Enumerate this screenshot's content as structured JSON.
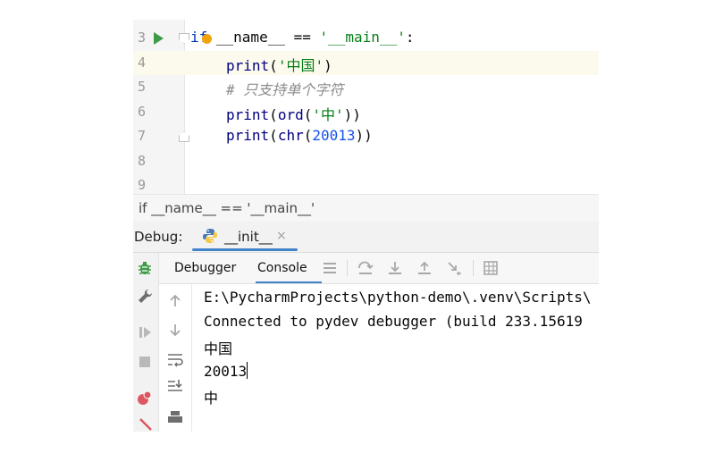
{
  "editor": {
    "lines": [
      {
        "number": "3",
        "parts": [
          {
            "t": "if",
            "c": "kw"
          },
          {
            "t": " __name__ == ",
            "c": "dunder"
          },
          {
            "t": "'__main__'",
            "c": "str"
          },
          {
            "t": ":",
            "c": ""
          }
        ]
      },
      {
        "number": "4",
        "parts": [
          {
            "t": "print",
            "c": "fn"
          },
          {
            "t": "(",
            "c": ""
          },
          {
            "t": "'中国'",
            "c": "str"
          },
          {
            "t": ")",
            "c": ""
          }
        ]
      },
      {
        "number": "5",
        "parts": [
          {
            "t": "# 只支持单个字符",
            "c": "cmt"
          }
        ]
      },
      {
        "number": "6",
        "parts": [
          {
            "t": "print",
            "c": "fn"
          },
          {
            "t": "(",
            "c": ""
          },
          {
            "t": "ord",
            "c": "fn"
          },
          {
            "t": "(",
            "c": ""
          },
          {
            "t": "'中'",
            "c": "str"
          },
          {
            "t": "))",
            "c": ""
          }
        ]
      },
      {
        "number": "7",
        "parts": [
          {
            "t": "print",
            "c": "fn"
          },
          {
            "t": "(",
            "c": ""
          },
          {
            "t": "chr",
            "c": "fn"
          },
          {
            "t": "(",
            "c": ""
          },
          {
            "t": "20013",
            "c": "num"
          },
          {
            "t": "))",
            "c": ""
          }
        ]
      },
      {
        "number": "8",
        "parts": []
      },
      {
        "number": "9",
        "parts": []
      }
    ],
    "current_line": 1
  },
  "breadcrumb": {
    "text": "if __name__ == '__main__'"
  },
  "debug": {
    "title": "Debug:",
    "session_tab": "__init__",
    "session_close": "×",
    "tabs": {
      "debugger": "Debugger",
      "console": "Console"
    },
    "active_tab": "console"
  },
  "console": {
    "lines": [
      "E:\\PycharmProjects\\python-demo\\.venv\\Scripts\\",
      "Connected to pydev debugger (build 233.15619",
      "中国",
      "20013",
      "中"
    ]
  },
  "colors": {
    "accent": "#4083c9",
    "run": "#3d9b48",
    "keyword": "#0033b3",
    "string": "#067d17",
    "number": "#1750eb",
    "comment": "#8c8c8c"
  }
}
